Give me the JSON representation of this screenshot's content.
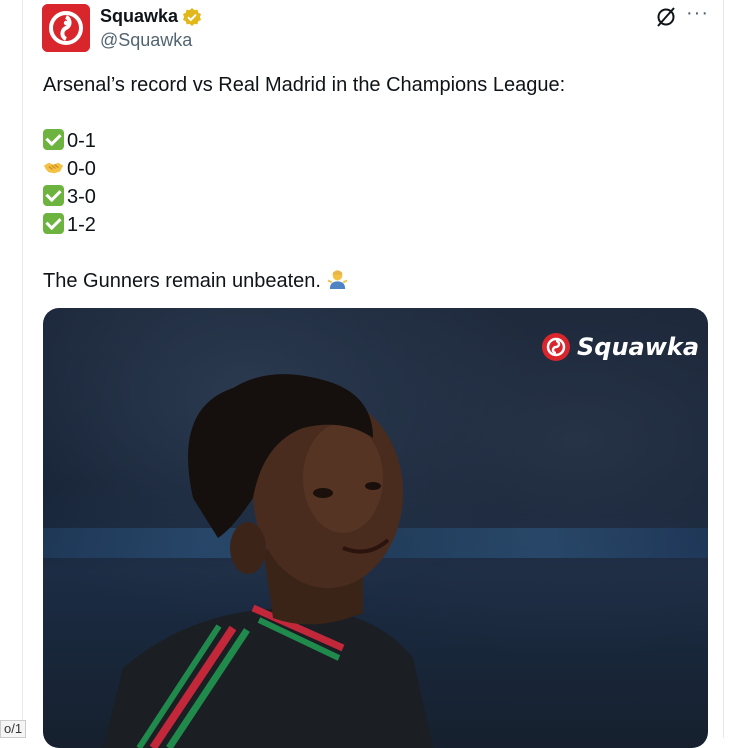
{
  "author": {
    "display_name": "Squawka",
    "handle": "@Squawka"
  },
  "tweet": {
    "intro": "Arsenal’s record vs Real Madrid in the Champions League:",
    "results": [
      {
        "icon": "check-mark-icon",
        "score": "0-1"
      },
      {
        "icon": "handshake-icon",
        "score": "0-0"
      },
      {
        "icon": "check-mark-icon",
        "score": "3-0"
      },
      {
        "icon": "check-mark-icon",
        "score": "1-2"
      }
    ],
    "closing": "The Gunners remain unbeaten.",
    "closing_emoji": "person-shrugging-icon"
  },
  "media": {
    "watermark": "Squawka",
    "description_icon": "player-photo"
  },
  "side_label": "o/1",
  "colors": {
    "brand_red": "#d9262c",
    "verified_gold": "#e2b719",
    "check_green": "#6db33f"
  }
}
